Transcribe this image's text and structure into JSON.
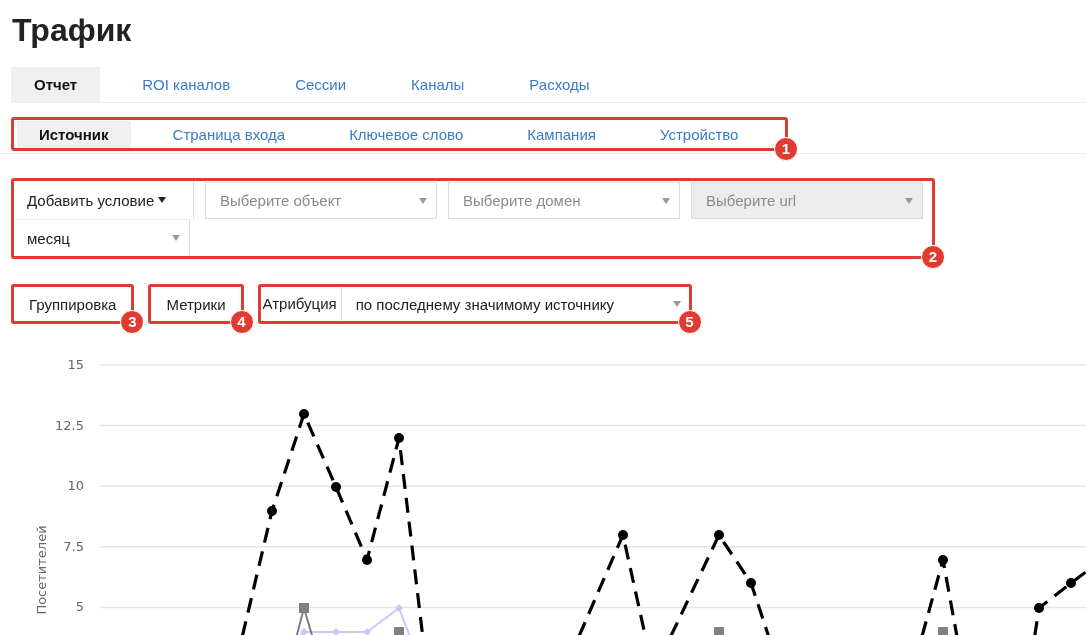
{
  "page_title": "Трафик",
  "tabs": [
    {
      "label": "Отчет",
      "selected": true
    },
    {
      "label": "ROI каналов",
      "selected": false
    },
    {
      "label": "Сессии",
      "selected": false
    },
    {
      "label": "Каналы",
      "selected": false
    },
    {
      "label": "Расходы",
      "selected": false
    }
  ],
  "subtabs": {
    "annotation": "1",
    "items": [
      {
        "label": "Источник",
        "selected": true
      },
      {
        "label": "Страница входа",
        "selected": false
      },
      {
        "label": "Ключевое слово",
        "selected": false
      },
      {
        "label": "Кампания",
        "selected": false
      },
      {
        "label": "Устройство",
        "selected": false
      }
    ]
  },
  "filters": {
    "annotation": "2",
    "add_condition": "Добавить условие",
    "selects": [
      {
        "placeholder": "Выберите объект",
        "disabled": false
      },
      {
        "placeholder": "Выберите домен",
        "disabled": false
      },
      {
        "placeholder": "Выберите url",
        "disabled": true
      },
      {
        "value": "месяц",
        "disabled": false
      }
    ]
  },
  "grouping": {
    "label": "Группировка",
    "annotation": "3"
  },
  "metrics": {
    "label": "Метрики",
    "annotation": "4"
  },
  "attribution": {
    "label": "Атрибуция",
    "value": "по последнему значимому источнику",
    "annotation": "5"
  },
  "chart": {
    "y_axis_title": "Посетителей",
    "y_tick_labels": [
      "15",
      "12.5",
      "10",
      "7.5",
      "5"
    ]
  }
}
